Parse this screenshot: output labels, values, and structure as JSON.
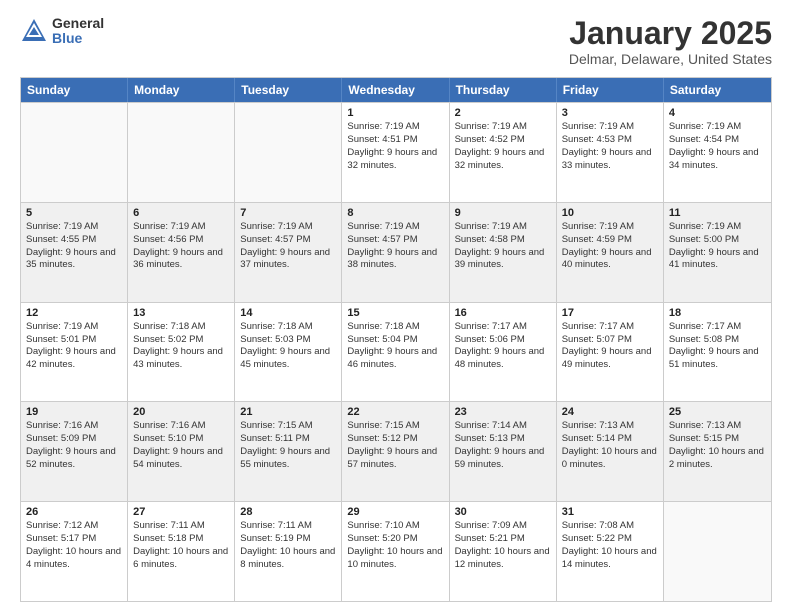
{
  "logo": {
    "general": "General",
    "blue": "Blue"
  },
  "title": {
    "month": "January 2025",
    "location": "Delmar, Delaware, United States"
  },
  "days_of_week": [
    "Sunday",
    "Monday",
    "Tuesday",
    "Wednesday",
    "Thursday",
    "Friday",
    "Saturday"
  ],
  "weeks": [
    [
      {
        "day": "",
        "info": ""
      },
      {
        "day": "",
        "info": ""
      },
      {
        "day": "",
        "info": ""
      },
      {
        "day": "1",
        "info": "Sunrise: 7:19 AM\nSunset: 4:51 PM\nDaylight: 9 hours and 32 minutes."
      },
      {
        "day": "2",
        "info": "Sunrise: 7:19 AM\nSunset: 4:52 PM\nDaylight: 9 hours and 32 minutes."
      },
      {
        "day": "3",
        "info": "Sunrise: 7:19 AM\nSunset: 4:53 PM\nDaylight: 9 hours and 33 minutes."
      },
      {
        "day": "4",
        "info": "Sunrise: 7:19 AM\nSunset: 4:54 PM\nDaylight: 9 hours and 34 minutes."
      }
    ],
    [
      {
        "day": "5",
        "info": "Sunrise: 7:19 AM\nSunset: 4:55 PM\nDaylight: 9 hours and 35 minutes."
      },
      {
        "day": "6",
        "info": "Sunrise: 7:19 AM\nSunset: 4:56 PM\nDaylight: 9 hours and 36 minutes."
      },
      {
        "day": "7",
        "info": "Sunrise: 7:19 AM\nSunset: 4:57 PM\nDaylight: 9 hours and 37 minutes."
      },
      {
        "day": "8",
        "info": "Sunrise: 7:19 AM\nSunset: 4:57 PM\nDaylight: 9 hours and 38 minutes."
      },
      {
        "day": "9",
        "info": "Sunrise: 7:19 AM\nSunset: 4:58 PM\nDaylight: 9 hours and 39 minutes."
      },
      {
        "day": "10",
        "info": "Sunrise: 7:19 AM\nSunset: 4:59 PM\nDaylight: 9 hours and 40 minutes."
      },
      {
        "day": "11",
        "info": "Sunrise: 7:19 AM\nSunset: 5:00 PM\nDaylight: 9 hours and 41 minutes."
      }
    ],
    [
      {
        "day": "12",
        "info": "Sunrise: 7:19 AM\nSunset: 5:01 PM\nDaylight: 9 hours and 42 minutes."
      },
      {
        "day": "13",
        "info": "Sunrise: 7:18 AM\nSunset: 5:02 PM\nDaylight: 9 hours and 43 minutes."
      },
      {
        "day": "14",
        "info": "Sunrise: 7:18 AM\nSunset: 5:03 PM\nDaylight: 9 hours and 45 minutes."
      },
      {
        "day": "15",
        "info": "Sunrise: 7:18 AM\nSunset: 5:04 PM\nDaylight: 9 hours and 46 minutes."
      },
      {
        "day": "16",
        "info": "Sunrise: 7:17 AM\nSunset: 5:06 PM\nDaylight: 9 hours and 48 minutes."
      },
      {
        "day": "17",
        "info": "Sunrise: 7:17 AM\nSunset: 5:07 PM\nDaylight: 9 hours and 49 minutes."
      },
      {
        "day": "18",
        "info": "Sunrise: 7:17 AM\nSunset: 5:08 PM\nDaylight: 9 hours and 51 minutes."
      }
    ],
    [
      {
        "day": "19",
        "info": "Sunrise: 7:16 AM\nSunset: 5:09 PM\nDaylight: 9 hours and 52 minutes."
      },
      {
        "day": "20",
        "info": "Sunrise: 7:16 AM\nSunset: 5:10 PM\nDaylight: 9 hours and 54 minutes."
      },
      {
        "day": "21",
        "info": "Sunrise: 7:15 AM\nSunset: 5:11 PM\nDaylight: 9 hours and 55 minutes."
      },
      {
        "day": "22",
        "info": "Sunrise: 7:15 AM\nSunset: 5:12 PM\nDaylight: 9 hours and 57 minutes."
      },
      {
        "day": "23",
        "info": "Sunrise: 7:14 AM\nSunset: 5:13 PM\nDaylight: 9 hours and 59 minutes."
      },
      {
        "day": "24",
        "info": "Sunrise: 7:13 AM\nSunset: 5:14 PM\nDaylight: 10 hours and 0 minutes."
      },
      {
        "day": "25",
        "info": "Sunrise: 7:13 AM\nSunset: 5:15 PM\nDaylight: 10 hours and 2 minutes."
      }
    ],
    [
      {
        "day": "26",
        "info": "Sunrise: 7:12 AM\nSunset: 5:17 PM\nDaylight: 10 hours and 4 minutes."
      },
      {
        "day": "27",
        "info": "Sunrise: 7:11 AM\nSunset: 5:18 PM\nDaylight: 10 hours and 6 minutes."
      },
      {
        "day": "28",
        "info": "Sunrise: 7:11 AM\nSunset: 5:19 PM\nDaylight: 10 hours and 8 minutes."
      },
      {
        "day": "29",
        "info": "Sunrise: 7:10 AM\nSunset: 5:20 PM\nDaylight: 10 hours and 10 minutes."
      },
      {
        "day": "30",
        "info": "Sunrise: 7:09 AM\nSunset: 5:21 PM\nDaylight: 10 hours and 12 minutes."
      },
      {
        "day": "31",
        "info": "Sunrise: 7:08 AM\nSunset: 5:22 PM\nDaylight: 10 hours and 14 minutes."
      },
      {
        "day": "",
        "info": ""
      }
    ]
  ]
}
